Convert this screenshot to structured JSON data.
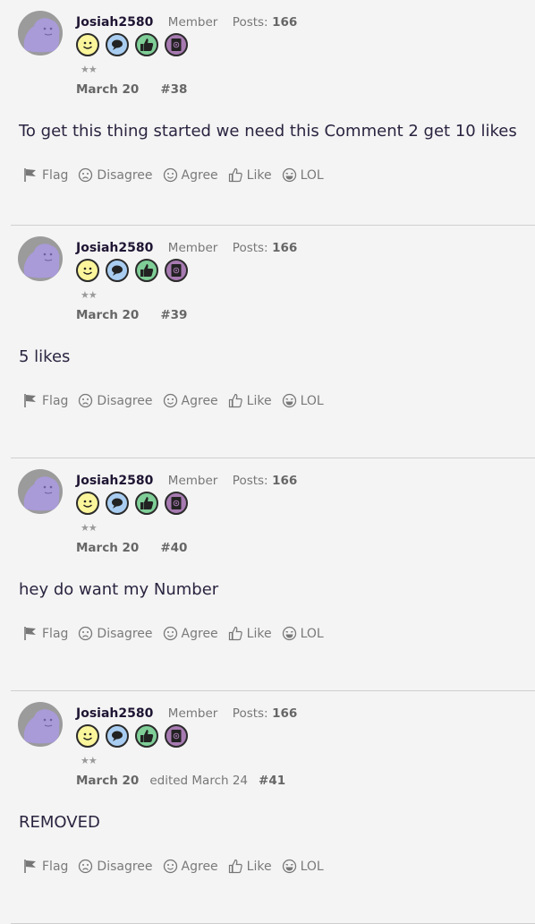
{
  "posts": [
    {
      "username": "Josiah2580",
      "role": "Member",
      "posts_label": "Posts:",
      "posts_count": "166",
      "date": "March 20",
      "edited": "",
      "permalink": "#38",
      "body": "To get this thing started we need this Comment 2 get 10 likes",
      "stars": "★★"
    },
    {
      "username": "Josiah2580",
      "role": "Member",
      "posts_label": "Posts:",
      "posts_count": "166",
      "date": "March 20",
      "edited": "",
      "permalink": "#39",
      "body": "5 likes",
      "stars": "★★"
    },
    {
      "username": "Josiah2580",
      "role": "Member",
      "posts_label": "Posts:",
      "posts_count": "166",
      "date": "March 20",
      "edited": "",
      "permalink": "#40",
      "body": "hey do want my Number",
      "stars": "★★"
    },
    {
      "username": "Josiah2580",
      "role": "Member",
      "posts_label": "Posts:",
      "posts_count": "166",
      "date": "March 20",
      "edited": "edited March 24",
      "permalink": "#41",
      "body": "REMOVED",
      "stars": "★★"
    }
  ],
  "reactions": {
    "flag": "Flag",
    "disagree": "Disagree",
    "agree": "Agree",
    "like": "Like",
    "lol": "LOL"
  },
  "badge_icons": [
    "smiley-badge-icon",
    "chat-badge-icon",
    "thumbs-up-badge-icon",
    "notebook-badge-icon"
  ],
  "colors": {
    "username": "#1f1533",
    "body_text": "#2b2440",
    "reaction_text": "#7a7a7a",
    "avatar_blob": "#a99ad8"
  }
}
